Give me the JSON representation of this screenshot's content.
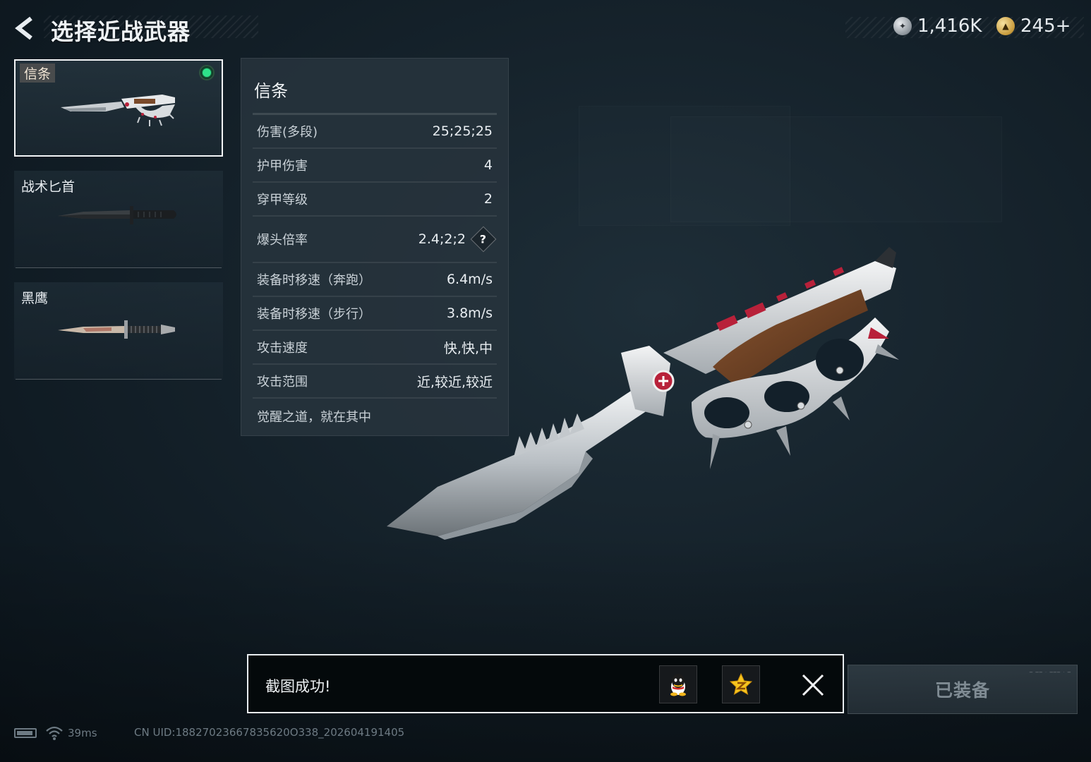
{
  "header": {
    "title": "选择近战武器",
    "currencies": [
      {
        "icon": "silver-coin-icon",
        "amount": "1,416K"
      },
      {
        "icon": "gold-coin-icon",
        "amount": "245+"
      }
    ]
  },
  "weapons": [
    {
      "name": "信条",
      "selected": true,
      "equipped": true
    },
    {
      "name": "战术匕首",
      "selected": false,
      "equipped": false
    },
    {
      "name": "黑鹰",
      "selected": false,
      "equipped": false
    }
  ],
  "stats_panel": {
    "title": "信条",
    "rows": [
      {
        "label": "伤害(多段)",
        "value": "25;25;25"
      },
      {
        "label": "护甲伤害",
        "value": "4"
      },
      {
        "label": "穿甲等级",
        "value": "2"
      },
      {
        "label": "爆头倍率",
        "value": "2.4;2;2",
        "help": "?"
      },
      {
        "label": "装备时移速（奔跑）",
        "value": "6.4m/s"
      },
      {
        "label": "装备时移速（步行）",
        "value": "3.8m/s"
      },
      {
        "label": "攻击速度",
        "value": "快,快,中"
      },
      {
        "label": "攻击范围",
        "value": "近,较近,较近"
      }
    ],
    "description": "觉醒之道，就在其中"
  },
  "toast": {
    "message": "截图成功!",
    "share_buttons": [
      "qq-icon",
      "qzone-star-icon"
    ]
  },
  "equip_button": {
    "label": "已装备"
  },
  "status": {
    "ping": "39ms",
    "uid": "CN UID:18827023667835620O338_202604191405"
  },
  "colors": {
    "background": "#16232c",
    "panel": "#27333c",
    "equipped_indicator": "#2ee28a",
    "accent_red": "#b8213a"
  }
}
